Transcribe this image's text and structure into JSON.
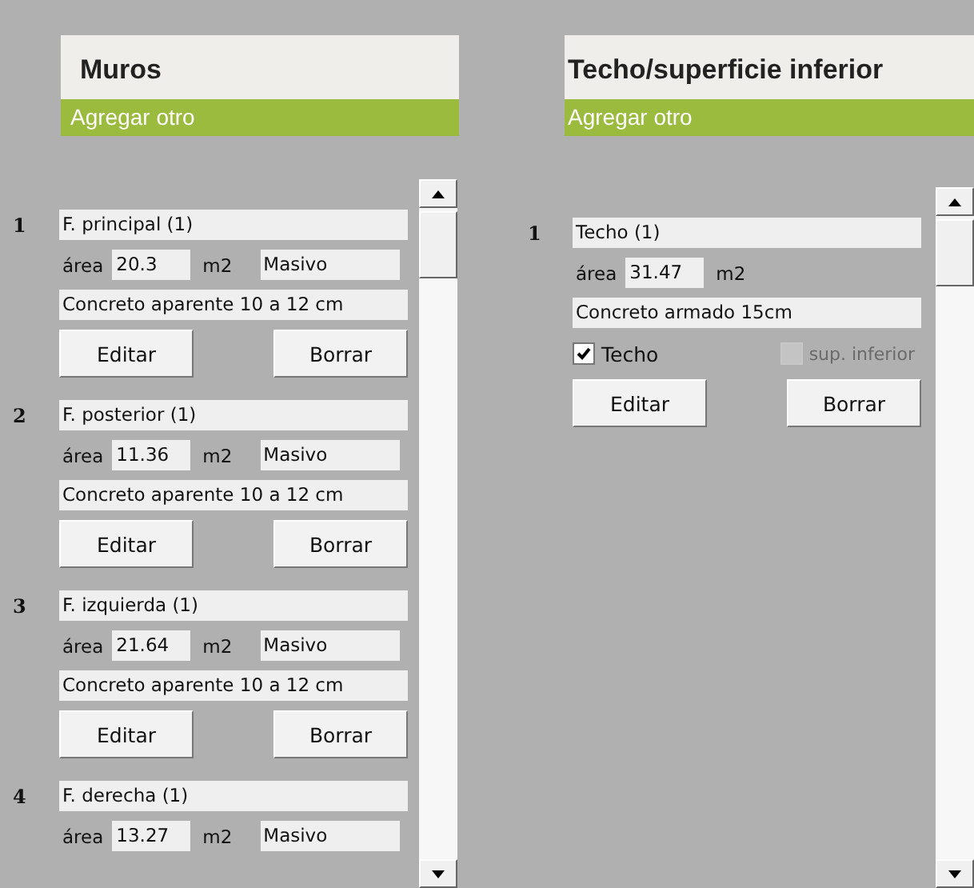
{
  "panels": [
    {
      "title": "Muros",
      "add_label": "Agregar otro",
      "items": [
        {
          "number": "1",
          "name": "F. principal (1)",
          "area_label": "área",
          "area": "20.3",
          "unit": "m2",
          "type": "Masivo",
          "description": "Concreto aparente 10 a 12 cm",
          "buttons": [
            "Editar",
            "Borrar"
          ]
        },
        {
          "number": "2",
          "name": "F. posterior (1)",
          "area_label": "área",
          "area": "11.36",
          "unit": "m2",
          "type": "Masivo",
          "description": "Concreto aparente 10 a 12 cm",
          "buttons": [
            "Editar",
            "Borrar"
          ]
        },
        {
          "number": "3",
          "name": "F. izquierda (1)",
          "area_label": "área",
          "area": "21.64",
          "unit": "m2",
          "type": "Masivo",
          "description": "Concreto aparente 10 a 12 cm",
          "buttons": [
            "Editar",
            "Borrar"
          ]
        },
        {
          "number": "4",
          "name": "F. derecha (1)",
          "area_label": "área",
          "area": "13.27",
          "unit": "m2",
          "type": "Masivo"
        }
      ]
    },
    {
      "title": "Techo/superficie inferior",
      "add_label": "Agregar otro",
      "items": [
        {
          "number": "1",
          "name": "Techo (1)",
          "area_label": "área",
          "area": "31.47",
          "unit": "m2",
          "description": "Concreto armado 15cm",
          "checkboxes": [
            {
              "label": "Techo",
              "checked": true,
              "disabled": false
            },
            {
              "label": "sup. inferior",
              "checked": false,
              "disabled": true
            }
          ],
          "buttons": [
            "Editar",
            "Borrar"
          ]
        }
      ]
    }
  ]
}
